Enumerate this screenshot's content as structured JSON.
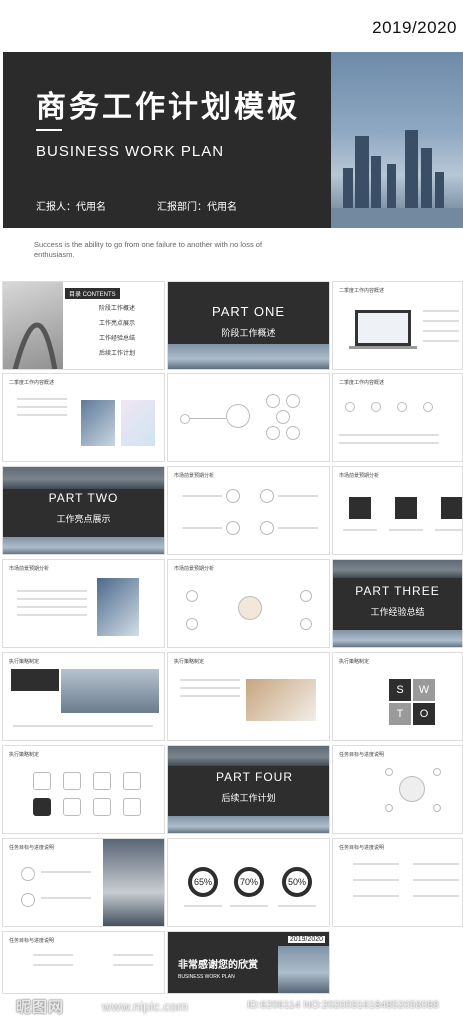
{
  "cover": {
    "year": "2019/2020",
    "title": "商务工作计划模板",
    "subtitle": "BUSINESS WORK PLAN",
    "reporter": "汇报人：代用名",
    "department": "汇报部门：代用名",
    "quote": "Success is the ability to go from one failure to another with no loss of enthusiasm."
  },
  "slides": {
    "contents_label": "目录 CONTENTS",
    "contents_items": [
      "阶段工作概述",
      "工作亮点展示",
      "工作经验总结",
      "后续工作计划"
    ],
    "part_one": "PART ONE",
    "part_one_title": "阶段工作概述",
    "part_two": "PART TWO",
    "part_two_title": "工作亮点展示",
    "part_three": "PART THREE",
    "part_three_title": "工作经验总结",
    "part_four": "PART FOUR",
    "part_four_title": "后续工作计划",
    "hdr_overview": "二季度工作内容概述",
    "hdr_highlight": "市场前景预期分析",
    "hdr_plan": "执行策略制定",
    "hdr_goal": "任务目标与进度说明",
    "swot": [
      "S",
      "W",
      "T",
      "O"
    ],
    "percents": [
      "65%",
      "70%",
      "50%"
    ],
    "thanks": "非常感谢您的欣赏",
    "thanks_sub": "BUSINESS WORK PLAN",
    "thanks_year": "2019/2020"
  },
  "watermark": {
    "logo": "昵图网",
    "url": "www.nipic.com",
    "id": "ID:6206114 NO:20200316184852058088"
  }
}
